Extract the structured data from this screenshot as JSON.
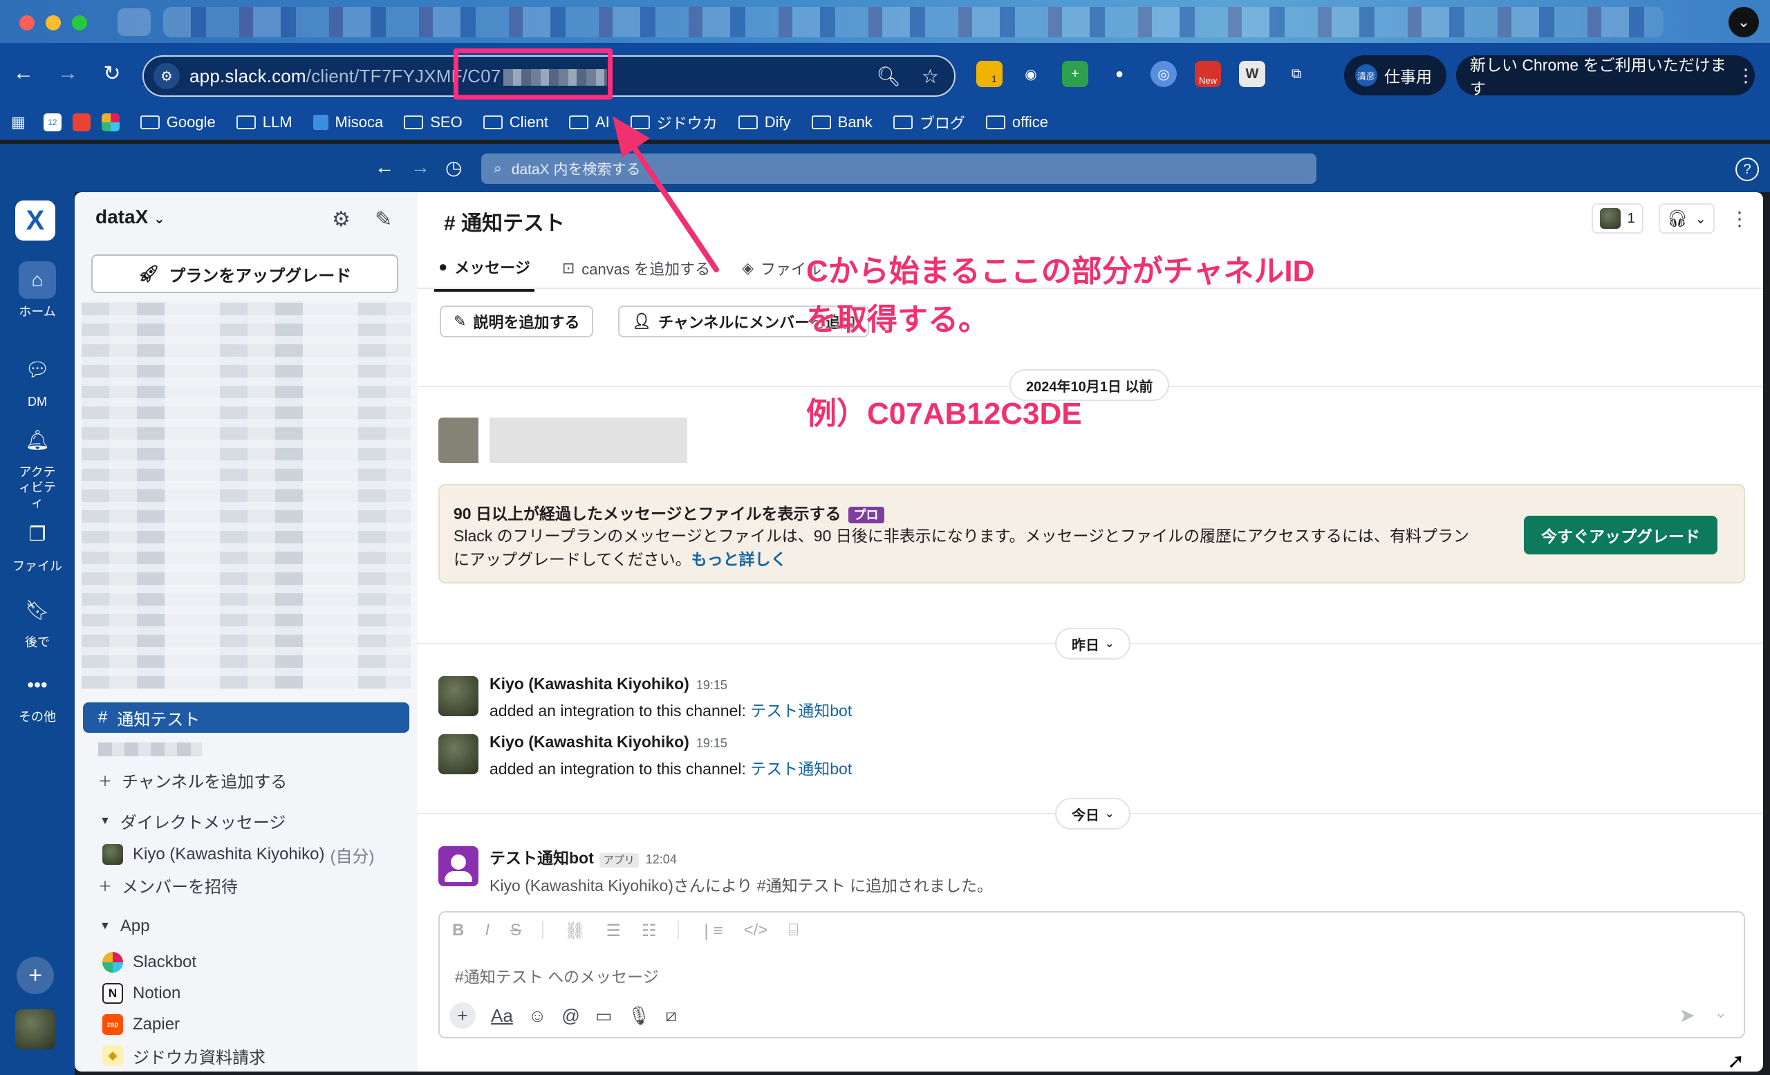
{
  "browser": {
    "url_host": "app.slack.com",
    "url_path": "/client/TF7FYJXMF/C07",
    "profile_label": "仕事用",
    "profile_badge": "清彦",
    "update_label": "新しい Chrome をご利用いただけます",
    "ext_new_badge": "New",
    "ext_count_badge": "1",
    "bookmarks": [
      {
        "label": "Google",
        "type": "folder"
      },
      {
        "label": "LLM",
        "type": "folder"
      },
      {
        "label": "Misoca",
        "type": "site"
      },
      {
        "label": "SEO",
        "type": "folder"
      },
      {
        "label": "Client",
        "type": "folder"
      },
      {
        "label": "AI",
        "type": "folder"
      },
      {
        "label": "ジドウカ",
        "type": "folder"
      },
      {
        "label": "Dify",
        "type": "folder"
      },
      {
        "label": "Bank",
        "type": "folder"
      },
      {
        "label": "ブログ",
        "type": "folder"
      },
      {
        "label": "office",
        "type": "folder"
      }
    ],
    "calendar_badge": "12"
  },
  "slack": {
    "search_placeholder": "dataX 内を検索する",
    "workspace": "dataX",
    "workspace_logo": "X",
    "rail": [
      {
        "label": "ホーム",
        "icon": "home-icon"
      },
      {
        "label": "DM",
        "icon": "dm-icon"
      },
      {
        "label": "アクティビティ",
        "icon": "bell-icon"
      },
      {
        "label": "ファイル",
        "icon": "files-icon"
      },
      {
        "label": "後で",
        "icon": "bookmark-icon"
      },
      {
        "label": "その他",
        "icon": "more-icon"
      }
    ],
    "sidebar": {
      "upgrade_button": "プランをアップグレード",
      "active_channel": "通知テスト",
      "add_channel": "チャンネルを追加する",
      "dm_section": "ダイレクトメッセージ",
      "dm_user": "Kiyo (Kawashita Kiyohiko)",
      "dm_self": "(自分)",
      "invite": "メンバーを招待",
      "app_section": "App",
      "apps": [
        "Slackbot",
        "Notion",
        "Zapier",
        "ジドウカ資料請求"
      ]
    },
    "channel": {
      "title": "通知テスト",
      "member_count": "1",
      "tabs": [
        {
          "label": "メッセージ",
          "active": true
        },
        {
          "label": "canvas を追加する",
          "active": false
        },
        {
          "label": "ファイル",
          "active": false
        }
      ],
      "add_description": "説明を追加する",
      "add_members": "チャンネルにメンバーを追加"
    },
    "messages": {
      "date_old": "2024年10月1日 以前",
      "banner_title": "90 日以上が経過したメッセージとファイルを表示する",
      "banner_badge": "プロ",
      "banner_text": "Slack のフリープランのメッセージとファイルは、90 日後に非表示になります。メッセージとファイルの履歴にアクセスするには、有料プランにアップグレードしてください。",
      "banner_more": "もっと詳しく",
      "banner_cta": "今すぐアップグレード",
      "date_yesterday": "昨日",
      "date_today": "今日",
      "items": [
        {
          "name": "Kiyo (Kawashita Kiyohiko)",
          "time": "19:15",
          "text": "added an integration to this channel: ",
          "link": "テスト通知bot"
        },
        {
          "name": "Kiyo (Kawashita Kiyohiko)",
          "time": "19:15",
          "text": "added an integration to this channel: ",
          "link": "テスト通知bot"
        }
      ],
      "bot": {
        "name": "テスト通知bot",
        "tag": "アプリ",
        "time": "12:04",
        "text": "Kiyo (Kawashita Kiyohiko)さんにより #通知テスト に追加されました。"
      }
    },
    "composer_placeholder": "#通知テスト へのメッセージ"
  },
  "annotation": {
    "line1": "Cから始まるここの部分がチャネルID",
    "line2": "を取得する。",
    "example": "例）C07AB12C3DE",
    "color": "#f0306f"
  }
}
